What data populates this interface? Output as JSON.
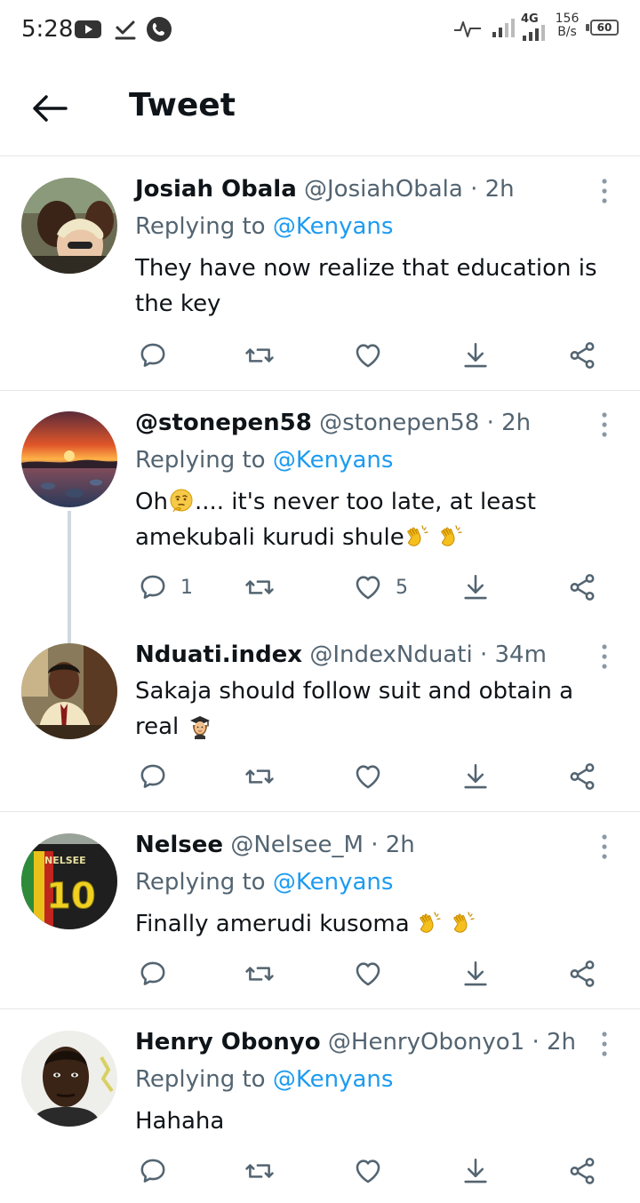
{
  "status_bar": {
    "time": "5:28",
    "network": "4G",
    "speed_value": "156",
    "speed_unit": "B/s",
    "battery": "60"
  },
  "header": {
    "title": "Tweet"
  },
  "tweets": [
    {
      "display_name": "Josiah Obala",
      "handle": "@JosiahObala",
      "time": "2h",
      "replying_prefix": "Replying to",
      "replying_to": "@Kenyans",
      "text": "They have now realize that education is the key",
      "reply_count": "",
      "like_count": ""
    },
    {
      "display_name": "@stonepen58",
      "handle": "@stonepen58",
      "time": "2h",
      "replying_prefix": "Replying to",
      "replying_to": "@Kenyans",
      "text_part1": "Oh",
      "text_part2": ".... it's never too late, at least amekubali kurudi shule",
      "reply_count": "1",
      "like_count": "5"
    },
    {
      "display_name": "Nduati.index",
      "handle": "@IndexNduati",
      "time": "34m",
      "text": "Sakaja should follow suit and obtain a real ",
      "reply_count": "",
      "like_count": ""
    },
    {
      "display_name": "Nelsee",
      "handle": "@Nelsee_M",
      "time": "2h",
      "replying_prefix": "Replying to",
      "replying_to": "@Kenyans",
      "text": "Finally amerudi kusoma ",
      "jersey_name": "NELSEE",
      "jersey_number": "10",
      "reply_count": "",
      "like_count": ""
    },
    {
      "display_name": "Henry Obonyo",
      "handle": "@HenryObonyo1",
      "time": "2h",
      "replying_prefix": "Replying to",
      "replying_to": "@Kenyans",
      "text": "Hahaha",
      "reply_count": "",
      "like_count": ""
    }
  ],
  "colors": {
    "link": "#1d9bf0",
    "secondary_text": "#536471",
    "icon": "#536471",
    "divider": "#e6e6e6"
  }
}
